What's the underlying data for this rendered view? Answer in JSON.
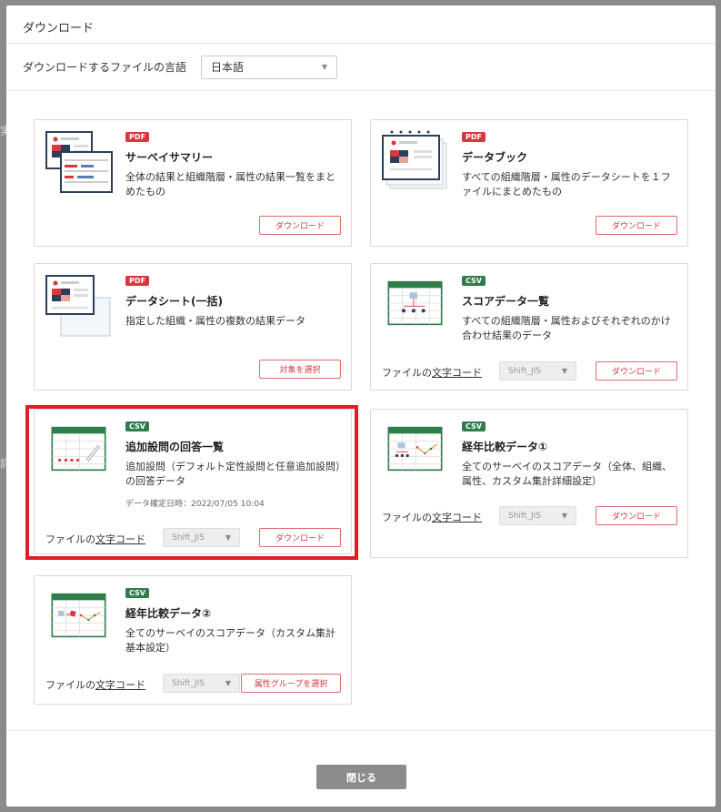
{
  "background": {
    "frag1": "実",
    "frag2": "詳"
  },
  "modal": {
    "title": "ダウンロード",
    "lang_label": "ダウンロードするファイルの言語",
    "lang_value": "日本語",
    "close_label": "閉じる"
  },
  "encoding": {
    "label_prefix": "ファイルの",
    "label_link": "文字コード",
    "value": "Shift_JIS"
  },
  "cards": [
    {
      "badge": "PDF",
      "title": "サーベイサマリー",
      "desc": "全体の結果と組織階層・属性の結果一覧をまとめたもの",
      "button": "ダウンロード"
    },
    {
      "badge": "PDF",
      "title": "データブック",
      "desc": "すべての組織階層・属性のデータシートを１ファイルにまとめたもの",
      "button": "ダウンロード"
    },
    {
      "badge": "PDF",
      "title": "データシート(一括)",
      "desc": "指定した組織・属性の複数の結果データ",
      "button": "対象を選択"
    },
    {
      "badge": "CSV",
      "title": "スコアデータ一覧",
      "desc": "すべての組織階層・属性およびそれぞれのかけ合わせ結果のデータ",
      "button": "ダウンロード"
    },
    {
      "badge": "CSV",
      "title": "追加設問の回答一覧",
      "desc": "追加設問（デフォルト定性設問と任意追加設問）の回答データ",
      "date": "データ確定日時：2022/07/05 10:04",
      "button": "ダウンロード"
    },
    {
      "badge": "CSV",
      "title": "経年比較データ①",
      "desc": "全てのサーベイのスコアデータ（全体、組織、属性、カスタム集計詳細設定）",
      "button": "ダウンロード"
    },
    {
      "badge": "CSV",
      "title": "経年比較データ②",
      "desc": "全てのサーベイのスコアデータ（カスタム集計基本設定）",
      "button": "属性グループを選択"
    }
  ],
  "colors": {
    "pdf": "#d9363e",
    "csv": "#2f7d4a",
    "highlight": "#e01c24"
  }
}
